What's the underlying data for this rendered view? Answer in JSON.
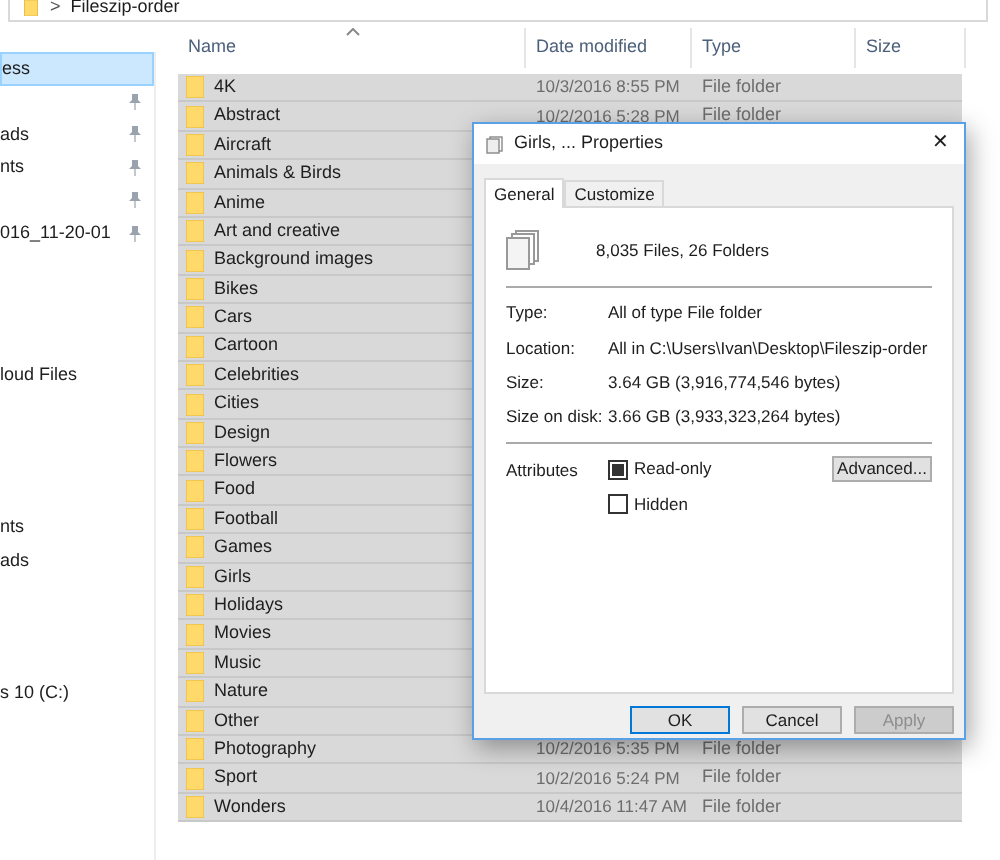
{
  "address_bar": {
    "separator": ">",
    "path": "Fileszip-order"
  },
  "sidebar": {
    "sections": [
      {
        "items": [
          {
            "label": "ess",
            "selected": true,
            "pinned": false
          },
          {
            "selected": false,
            "pinned": true
          },
          {
            "label": "ads",
            "selected": false,
            "pinned": true
          },
          {
            "label": "nts",
            "selected": false,
            "pinned": true
          },
          {
            "selected": false,
            "pinned": true
          },
          {
            "label": "016_11-20-01",
            "selected": false,
            "pinned": true
          }
        ]
      },
      {
        "items": [
          {
            "label": "loud Files",
            "selected": false,
            "pinned": false
          }
        ]
      },
      {
        "items": [
          {
            "label": "nts",
            "selected": false,
            "pinned": false
          },
          {
            "label": "ads",
            "selected": false,
            "pinned": false
          }
        ]
      },
      {
        "items": [
          {
            "label": "s 10 (C:)",
            "selected": false,
            "pinned": false
          }
        ]
      }
    ]
  },
  "table": {
    "columns": [
      "Name",
      "Date modified",
      "Type",
      "Size"
    ],
    "rows": [
      {
        "name": "4K",
        "date": "10/3/2016 8:55 PM",
        "type": "File folder",
        "selected": true
      },
      {
        "name": "Abstract",
        "date": "10/2/2016 5:28 PM",
        "type": "File folder",
        "selected": true
      },
      {
        "name": "Aircraft",
        "selected": true
      },
      {
        "name": "Animals & Birds",
        "selected": true
      },
      {
        "name": "Anime",
        "selected": true
      },
      {
        "name": "Art and creative",
        "selected": true
      },
      {
        "name": "Background images",
        "selected": true
      },
      {
        "name": "Bikes",
        "selected": true
      },
      {
        "name": "Cars",
        "selected": true
      },
      {
        "name": "Cartoon",
        "selected": true
      },
      {
        "name": "Celebrities",
        "selected": true
      },
      {
        "name": "Cities",
        "selected": true
      },
      {
        "name": "Design",
        "selected": true
      },
      {
        "name": "Flowers",
        "selected": true
      },
      {
        "name": "Food",
        "selected": true
      },
      {
        "name": "Football",
        "selected": true
      },
      {
        "name": "Games",
        "selected": true
      },
      {
        "name": "Girls",
        "selected": true
      },
      {
        "name": "Holidays",
        "selected": true
      },
      {
        "name": "Movies",
        "selected": true
      },
      {
        "name": "Music",
        "selected": true
      },
      {
        "name": "Nature",
        "selected": true
      },
      {
        "name": "Other",
        "selected": true
      },
      {
        "name": "Photography",
        "date": "10/2/2016 5:35 PM",
        "type": "File folder",
        "selected": true
      },
      {
        "name": "Sport",
        "date": "10/2/2016 5:24 PM",
        "type": "File folder",
        "selected": true
      },
      {
        "name": "Wonders",
        "date": "10/4/2016 11:47 AM",
        "type": "File folder",
        "selected": true
      }
    ]
  },
  "dialog": {
    "title": "Girls, ... Properties",
    "close": "✕",
    "tabs": [
      {
        "label": "General",
        "selected": true
      },
      {
        "label": "Customize",
        "selected": false
      }
    ],
    "summary": "8,035 Files, 26 Folders",
    "properties": [
      {
        "label": "Type:",
        "value": "All of type File folder"
      },
      {
        "label": "Location:",
        "value": "All in C:\\Users\\Ivan\\Desktop\\Fileszip-order"
      },
      {
        "label": "Size:",
        "value": "3.64 GB (3,916,774,546 bytes)"
      },
      {
        "label": "Size on disk:",
        "value": "3.66 GB (3,933,323,264 bytes)"
      }
    ],
    "attributes_label": "Attributes",
    "attributes": [
      {
        "label": "Read-only",
        "checked": true
      },
      {
        "label": "Hidden",
        "checked": false
      }
    ],
    "advanced_button": "Advanced...",
    "buttons": [
      {
        "label": "OK",
        "default": true,
        "disabled": false
      },
      {
        "label": "Cancel",
        "default": false,
        "disabled": false
      },
      {
        "label": "Apply",
        "default": false,
        "disabled": true
      }
    ]
  }
}
